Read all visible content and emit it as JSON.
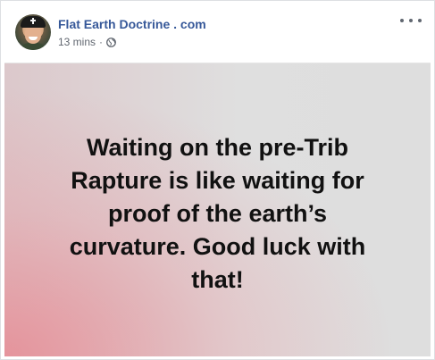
{
  "post": {
    "page_name": "Flat Earth Doctrine . com",
    "timestamp": "13 mins",
    "separator": "·",
    "audience_icon": "globe-icon",
    "more_icon": "more-options-icon",
    "quote_lines": [
      "Waiting on the pre-Trib",
      "Rapture is like waiting for",
      "proof of the earth’s",
      "curvature. Good luck with",
      "that!"
    ]
  },
  "colors": {
    "link_blue": "#365899",
    "meta_gray": "#616770",
    "quote_text": "#111111"
  }
}
